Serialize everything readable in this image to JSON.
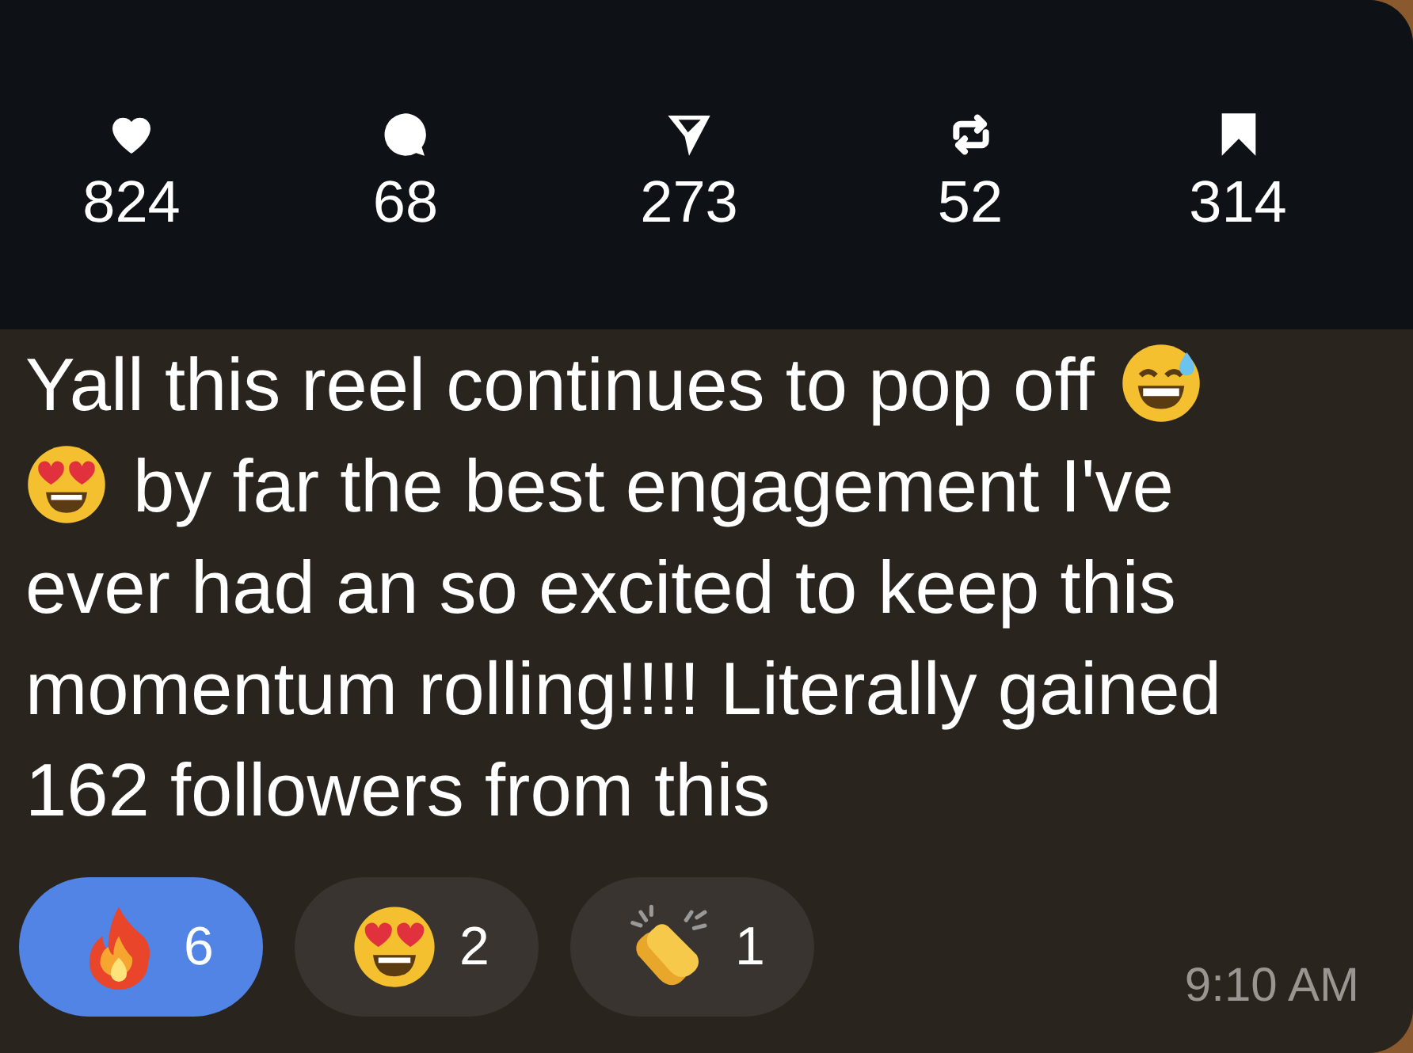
{
  "stats": [
    {
      "kind": "heart",
      "count": "824"
    },
    {
      "kind": "comment",
      "count": "68"
    },
    {
      "kind": "share",
      "count": "273"
    },
    {
      "kind": "repost",
      "count": "52"
    },
    {
      "kind": "bookmark",
      "count": "314"
    }
  ],
  "message": [
    [
      {
        "kind": "text",
        "text": "Yall this reel continues to pop off"
      },
      {
        "kind": "sweat-smile"
      }
    ],
    [
      {
        "kind": "heart-eyes"
      },
      {
        "kind": "text",
        "text": "by far the best engagement I've"
      }
    ],
    [
      {
        "kind": "text",
        "text": "ever had an so excited to keep this"
      }
    ],
    [
      {
        "kind": "text",
        "text": "momentum rolling!!!! Literally gained"
      }
    ],
    [
      {
        "kind": "text",
        "text": "162 followers from this"
      }
    ]
  ],
  "reactions": [
    {
      "kind": "fire",
      "count": "6",
      "selected": true
    },
    {
      "kind": "heart-eyes",
      "count": "2",
      "selected": false
    },
    {
      "kind": "clap",
      "count": "1",
      "selected": false
    }
  ],
  "time": "9:10 AM"
}
